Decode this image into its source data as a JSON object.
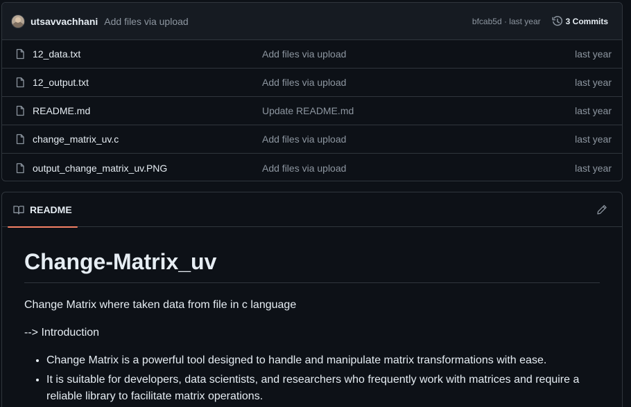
{
  "commit_bar": {
    "author": "utsavvachhani",
    "message": "Add files via upload",
    "hash_age": "bfcab5d · last year",
    "commits_label": "3 Commits"
  },
  "files": [
    {
      "name": "12_data.txt",
      "commit": "Add files via upload",
      "age": "last year"
    },
    {
      "name": "12_output.txt",
      "commit": "Add files via upload",
      "age": "last year"
    },
    {
      "name": "README.md",
      "commit": "Update README.md",
      "age": "last year"
    },
    {
      "name": "change_matrix_uv.c",
      "commit": "Add files via upload",
      "age": "last year"
    },
    {
      "name": "output_change_matrix_uv.PNG",
      "commit": "Add files via upload",
      "age": "last year"
    }
  ],
  "readme": {
    "tab_label": "README",
    "title": "Change-Matrix_uv",
    "description": "Change Matrix where taken data from file in c language",
    "intro": "--> Introduction",
    "bullets": [
      "Change Matrix is a powerful tool designed to handle and manipulate matrix transformations with ease.",
      "It is suitable for developers, data scientists, and researchers who frequently work with matrices and require a reliable library to facilitate matrix operations."
    ]
  },
  "icons": {
    "file": "file-icon",
    "history": "history-icon",
    "book": "book-icon",
    "edit": "pencil-icon"
  },
  "colors": {
    "background": "#0d1117",
    "header_bg": "#161b22",
    "border": "#30363d",
    "muted_text": "#8d96a0",
    "tab_underline": "#f78166"
  }
}
